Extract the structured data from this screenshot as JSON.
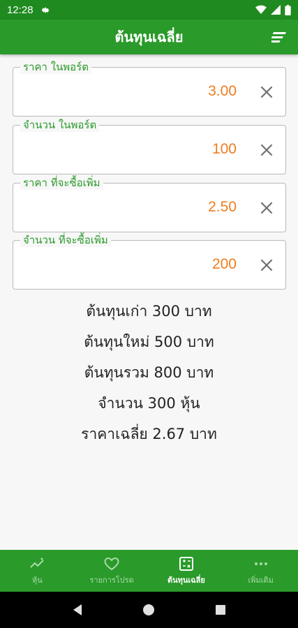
{
  "status_bar": {
    "time": "12:28"
  },
  "app_bar": {
    "title": "ต้นทุนเฉลี่ย"
  },
  "fields": [
    {
      "label": "ราคา ในพอร์ต",
      "value": "3.00"
    },
    {
      "label": "จำนวน ในพอร์ต",
      "value": "100"
    },
    {
      "label": "ราคา ที่จะซื้อเพิ่ม",
      "value": "2.50"
    },
    {
      "label": "จำนวน ที่จะซื้อเพิ่ม",
      "value": "200"
    }
  ],
  "results": {
    "old_cost": "ต้นทุนเก่า  300  บาท",
    "new_cost": "ต้นทุนใหม่  500  บาท",
    "total_cost": "ต้นทุนรวม  800  บาท",
    "quantity": "จำนวน  300  หุ้น",
    "average_price": "ราคาเฉลี่ย  2.67  บาท"
  },
  "bottom_nav": [
    {
      "label": "หุ้น",
      "icon": "trending-icon",
      "active": false
    },
    {
      "label": "รายการโปรด",
      "icon": "heart-icon",
      "active": false
    },
    {
      "label": "ต้นทุนเฉลี่ย",
      "icon": "calculator-icon",
      "active": true
    },
    {
      "label": "เพิ่มเติม",
      "icon": "more-icon",
      "active": false
    }
  ],
  "colors": {
    "primary": "#2a9a2a",
    "status_bar": "#1f8a1f",
    "value": "#ee7d1f",
    "label": "#2a9a2a"
  }
}
